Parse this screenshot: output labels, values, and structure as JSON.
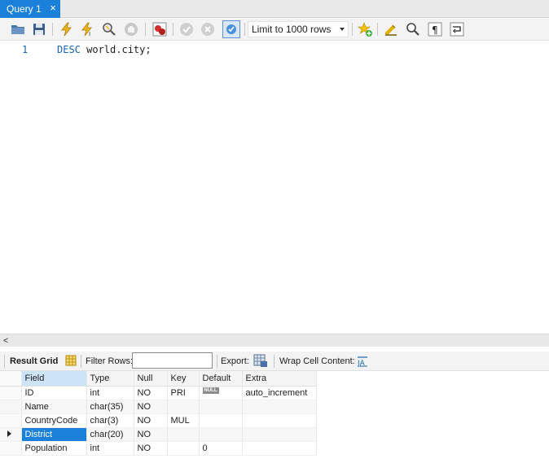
{
  "tab": {
    "title": "Query 1",
    "close_glyph": "×"
  },
  "toolbar": {
    "limit_label": "Limit to 1000 rows",
    "icons": [
      "open-folder-icon",
      "save-icon",
      "execute-icon",
      "execute-current-icon",
      "explain-icon",
      "stop-icon",
      "toggle-errors-icon",
      "commit-icon",
      "rollback-icon",
      "autocommit-icon",
      "favorite-add-icon",
      "beautify-icon",
      "find-icon",
      "invisible-chars-icon",
      "wrap-icon"
    ]
  },
  "editor": {
    "line_number": "1",
    "keyword": "DESC",
    "statement_rest": " world.city;"
  },
  "result_toolbar": {
    "result_grid_label": "Result Grid",
    "filter_rows_label": "Filter Rows:",
    "filter_value": "",
    "export_label": "Export:",
    "wrap_label": "Wrap Cell Content:"
  },
  "grid": {
    "columns": [
      "Field",
      "Type",
      "Null",
      "Key",
      "Default",
      "Extra"
    ],
    "rows": [
      {
        "field": "ID",
        "type": "int",
        "null": "NO",
        "key": "PRI",
        "default": "NULL",
        "extra": "auto_increment"
      },
      {
        "field": "Name",
        "type": "char(35)",
        "null": "NO",
        "key": "",
        "default": "",
        "extra": ""
      },
      {
        "field": "CountryCode",
        "type": "char(3)",
        "null": "NO",
        "key": "MUL",
        "default": "",
        "extra": ""
      },
      {
        "field": "District",
        "type": "char(20)",
        "null": "NO",
        "key": "",
        "default": "",
        "extra": ""
      },
      {
        "field": "Population",
        "type": "int",
        "null": "NO",
        "key": "",
        "default": "0",
        "extra": ""
      }
    ],
    "selected_row": 3
  },
  "colors": {
    "accent": "#1a80d9",
    "keyword": "#1a64b0"
  }
}
